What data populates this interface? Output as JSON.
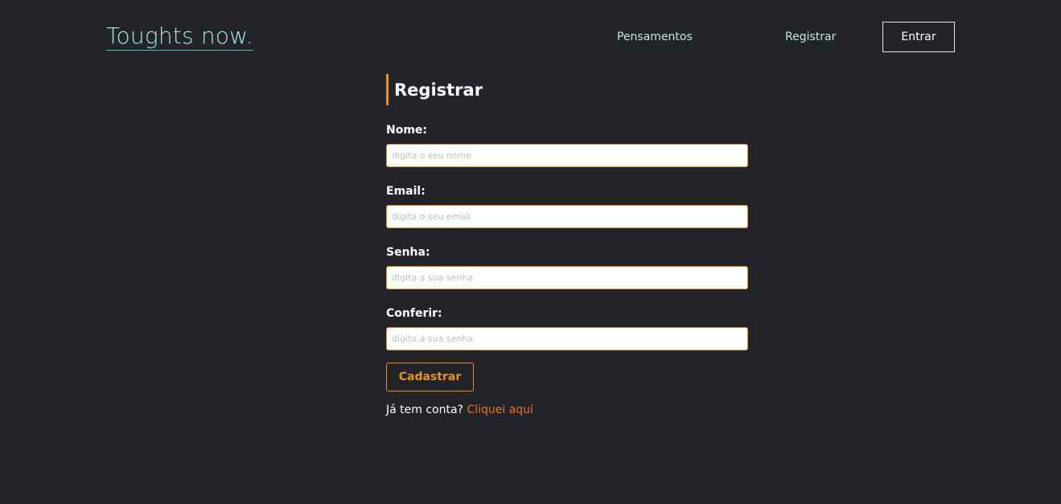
{
  "header": {
    "logo_text": "Toughts now.",
    "nav": {
      "pensamentos": "Pensamentos",
      "registrar": "Registrar",
      "entrar": "Entrar"
    }
  },
  "form": {
    "title": "Registrar",
    "fields": {
      "name": {
        "label": "Nome:",
        "placeholder": "digita o seu nome",
        "value": ""
      },
      "email": {
        "label": "Email:",
        "placeholder": "digita o seu email",
        "value": ""
      },
      "password": {
        "label": "Senha:",
        "placeholder": "digita a sua senha",
        "value": ""
      },
      "confirm": {
        "label": "Conferir:",
        "placeholder": "digita a sua senha",
        "value": ""
      }
    },
    "submit_label": "Cadastrar",
    "login_prompt_text": "Já tem conta?",
    "login_link_text": "Cliquei aqui"
  },
  "colors": {
    "background": "#23242a",
    "accent": "#e8902a",
    "link_orange": "#e8702a",
    "logo": "#a8e6e3",
    "nav_text": "#bfe8e6"
  }
}
